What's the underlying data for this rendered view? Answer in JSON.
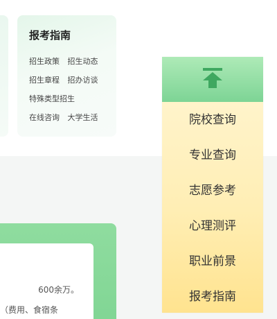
{
  "guide": {
    "title": "报考指南",
    "rows": [
      [
        "招生政策",
        "招生动态"
      ],
      [
        "招生章程",
        "招办访谈"
      ],
      [
        "特殊类型招生"
      ],
      [
        "在线咨询",
        "大学生活"
      ]
    ]
  },
  "side_nav": {
    "top_icon": "back-to-top-icon",
    "items": [
      "院校查询",
      "专业查询",
      "志愿参考",
      "心理测评",
      "职业前景",
      "报考指南"
    ],
    "colors": {
      "top_button": "#7dd495",
      "panel_top": "#fff6d4",
      "panel_bottom": "#ffe38f"
    }
  },
  "content_panel": {
    "line1": "600余万。",
    "line2": "（费用、食宿条"
  }
}
